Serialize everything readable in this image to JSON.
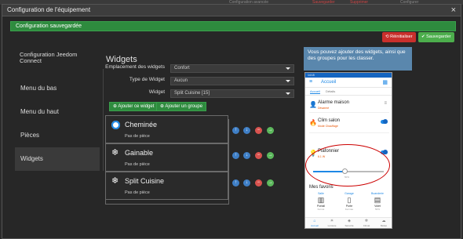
{
  "topstrip": {
    "t1": "Configuration avancée",
    "t2": "Sauvegarder",
    "t3": "Supprimer",
    "t4": "Configurer"
  },
  "window": {
    "title": "Configuration de l'équipement",
    "close": "×"
  },
  "alert": {
    "text": "Configuration sauvegardée"
  },
  "actions": {
    "reset_label": "Réinitialiser",
    "save_label": "Sauvegarder"
  },
  "tooltip": {
    "text": "Vous pouvez ajouter des widgets, ainsi que des groupes pour les classer."
  },
  "sidebar": {
    "header": "Configuration Jeedom Connect",
    "items": [
      {
        "label": "Menu du bas"
      },
      {
        "label": "Menu du haut"
      },
      {
        "label": "Pièces"
      },
      {
        "label": "Widgets"
      }
    ]
  },
  "main": {
    "title": "Widgets",
    "form": {
      "placement_label": "Emplacement des widgets",
      "placement_value": "Confort",
      "type_label": "Type de Widget",
      "type_value": "Aucun",
      "widget_label": "Widget",
      "widget_value": "Split Cuisine [15]"
    },
    "add_widget_label": "Ajouter ce widget",
    "add_group_label": "Ajouter un groupe",
    "widgets": [
      {
        "name": "Cheminée",
        "room": "Pas de pièce"
      },
      {
        "name": "Gainable",
        "room": "Pas de pièce"
      },
      {
        "name": "Split Cuisine",
        "room": "Pas de pièce"
      }
    ]
  },
  "phone": {
    "status": "14:15",
    "title": "Accueil",
    "tabs": [
      "Accueil",
      "Détails"
    ],
    "rows": [
      {
        "name": "Alarme maison",
        "sub": "Désarmé"
      },
      {
        "name": "Clim salon",
        "sub": "Mode Chauffage"
      },
      {
        "name": "Plafonnier",
        "sub": "6.1 W"
      }
    ],
    "slider_value": "50%",
    "slider_fraction": 0.45,
    "favorites_title": "Mes favoris",
    "favorites": [
      {
        "loc": "Salle",
        "name": "Portail",
        "sub": "Fermé"
      },
      {
        "loc": "Garage",
        "name": "Porte",
        "sub": "Fermée"
      },
      {
        "loc": "Buanderie",
        "name": "Volet",
        "sub": "50%"
      }
    ],
    "bottom": [
      "Accueil",
      "Lumière",
      "Sécurité",
      "Climat",
      "Météo"
    ]
  },
  "colors": {
    "accent": "#1e88e5",
    "success": "#2e8b3e",
    "danger": "#c9302c",
    "info": "#5a87ad"
  }
}
